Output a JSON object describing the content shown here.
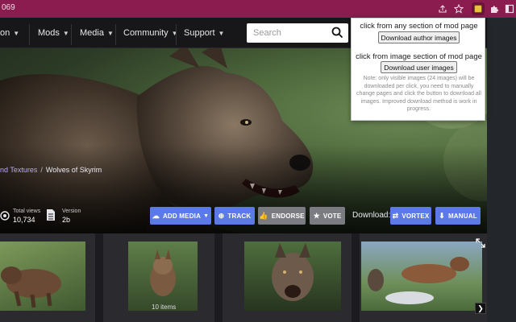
{
  "browser": {
    "url_fragment": "069",
    "icons": [
      "share-icon",
      "star-icon",
      "extension-active-icon",
      "puzzle-icon",
      "window-icon"
    ]
  },
  "nav": {
    "items": [
      {
        "label": "on",
        "has_chevron": true
      },
      {
        "label": "Mods",
        "has_chevron": true
      },
      {
        "label": "Media",
        "has_chevron": true
      },
      {
        "label": "Community",
        "has_chevron": true
      },
      {
        "label": "Support",
        "has_chevron": true
      }
    ],
    "search": {
      "placeholder": "Search"
    }
  },
  "breadcrumb": {
    "link": "nd Textures",
    "separator": "/",
    "current": "Wolves of Skyrim"
  },
  "stats": {
    "views_label": "Total views",
    "views_value": "10,734",
    "version_label": "Version",
    "version_value": "2b"
  },
  "actions": {
    "add_media": "ADD MEDIA",
    "track": "TRACK",
    "endorse": "ENDORSE",
    "vote": "VOTE",
    "download_label": "Download:",
    "vortex": "VORTEX",
    "manual": "MANUAL"
  },
  "gallery": {
    "count_label": "10 items"
  },
  "popup": {
    "text1": "click from any section of mod page",
    "button1": "Download author images",
    "text2": "click from image section of mod page",
    "button2": "Download user images",
    "note": "Note: only visible images (24 images) will be downloaded per click, you need to manually change pages and click the button to download all images. Improved download method is work in progress."
  },
  "colors": {
    "browser_bar": "#8a1c4f",
    "header_bg": "#17171a",
    "accent_blue": "#5b79e8",
    "grey_button": "#7b7b82",
    "breadcrumb_link": "#b7a8ff"
  }
}
